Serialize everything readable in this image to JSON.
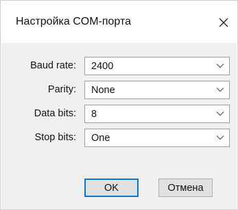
{
  "window": {
    "title": "Настройка COM-порта",
    "close_icon": "close-icon"
  },
  "form": {
    "baud_rate": {
      "label": "Baud rate:",
      "value": "2400"
    },
    "parity": {
      "label": "Parity:",
      "value": "None"
    },
    "data_bits": {
      "label": "Data bits:",
      "value": "8"
    },
    "stop_bits": {
      "label": "Stop bits:",
      "value": "One"
    },
    "dropdown_icon": "chevron-down-icon"
  },
  "buttons": {
    "ok": "OK",
    "cancel": "Отмена"
  },
  "colors": {
    "client_background": "#f0f0f0",
    "default_button_border": "#0078d7",
    "button_background": "#e1e1e1"
  }
}
